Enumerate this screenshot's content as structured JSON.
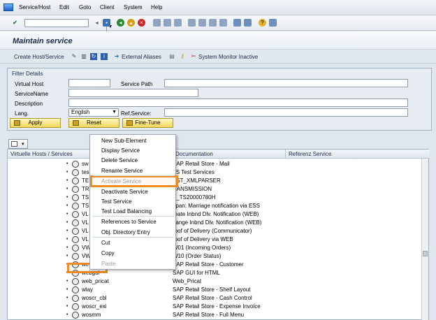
{
  "menubar": {
    "items": [
      "Service/Host",
      "Edit",
      "Goto",
      "Client",
      "System",
      "Help"
    ]
  },
  "title": "Maintain service",
  "app_toolbar": {
    "create": "Create Host/Service",
    "external_aliases": "External Aliases",
    "system_monitor": "System Monitor Inactive"
  },
  "filter": {
    "title": "Filter Details",
    "virtual_host_label": "Virtual Host",
    "virtual_host_value": "",
    "service_path_label": "Service Path",
    "service_path_value": "",
    "service_name_label": "ServiceName",
    "service_name_value": "",
    "description_label": "Description",
    "description_value": "",
    "lang_label": "Lang.",
    "lang_value": "English",
    "ref_service_label": "Ref.Service:",
    "ref_service_value": "",
    "apply_label": "Apply",
    "reset_label": "Reset",
    "finetune_label": "Fine-Tune"
  },
  "tree": {
    "columns": [
      "Virtuelle Hosts / Services",
      "Documentation",
      "Referenz Service"
    ],
    "rows": [
      {
        "name": "sw",
        "doc": "SAP Retail Store - Mail"
      },
      {
        "name": "tes",
        "doc": "TS Test Services"
      },
      {
        "name": "TE",
        "doc": "EST_XMLPARSER"
      },
      {
        "name": "TR",
        "doc": "RANSMISSION"
      },
      {
        "name": "TS",
        "doc": "S_TS20000780H"
      },
      {
        "name": "TS",
        "doc": "apan: Marriage notification via ESS"
      },
      {
        "name": "VL",
        "doc": "reate Inbnd Dlv. Notification (WEB)"
      },
      {
        "name": "VL",
        "doc": "hange Inbnd Dlv. Notification (WEB)"
      },
      {
        "name": "VL",
        "doc": "roof of Delivery (Communicator)"
      },
      {
        "name": "VL",
        "doc": "roof of Delivery via WEB"
      },
      {
        "name": "VW",
        "doc": "W01 (Incoming Orders)"
      },
      {
        "name": "VW",
        "doc": "W10 (Order Status)"
      },
      {
        "name": "wc",
        "doc": "SAP Retail Store - Customer"
      },
      {
        "name": "webgui",
        "doc": "SAP GUI for HTML"
      },
      {
        "name": "web_pricat",
        "doc": "Web_Pricat"
      },
      {
        "name": "wlay",
        "doc": "SAP Retail Store - Shelf Layout"
      },
      {
        "name": "woscr_cbl",
        "doc": "SAP Retail Store - Cash Control"
      },
      {
        "name": "woscr_exi",
        "doc": "SAP Retail Store - Expense Invoice"
      },
      {
        "name": "wosmm",
        "doc": "SAP Retail Store - Full Menu"
      }
    ]
  },
  "context_menu": {
    "items": [
      {
        "label": "New Sub-Element",
        "disabled": false
      },
      {
        "label": "Display Service",
        "disabled": false
      },
      {
        "label": "Delete Service",
        "disabled": false
      },
      {
        "label": "Rename Service",
        "disabled": false
      },
      {
        "label": "Activate Service",
        "disabled": true
      },
      {
        "label": "Deactivate Service",
        "disabled": false
      },
      {
        "label": "Test Service",
        "disabled": false
      },
      {
        "label": "Test Load Balancing",
        "disabled": false
      },
      {
        "label": "References to Service",
        "disabled": false
      },
      {
        "label": "Obj. Directory Entry",
        "disabled": false
      },
      {
        "label": "Cut",
        "disabled": false
      },
      {
        "label": "Copy",
        "disabled": false
      },
      {
        "label": "Paste",
        "disabled": true
      }
    ]
  },
  "colors": {
    "highlight": "#f08a24",
    "button_yellow": "#f1d65b"
  }
}
